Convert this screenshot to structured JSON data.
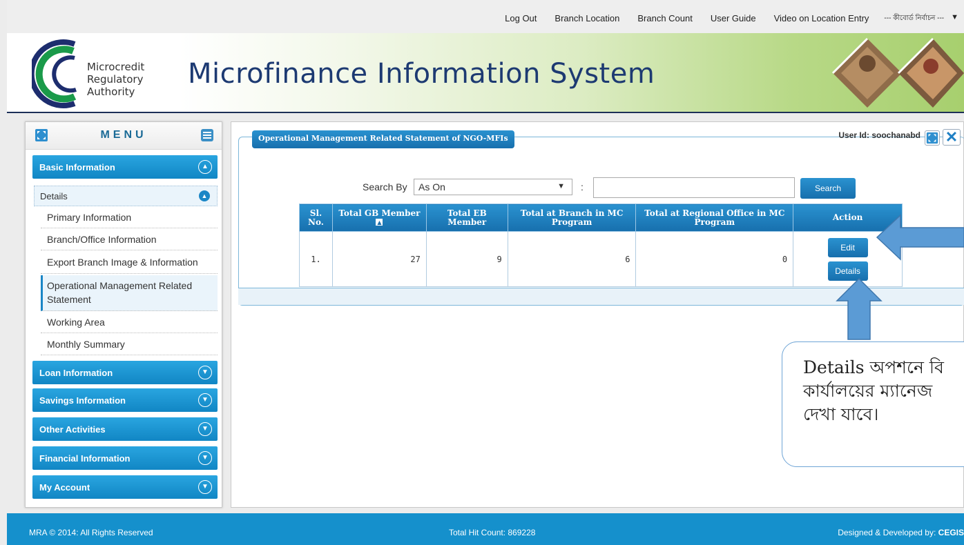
{
  "topnav": {
    "items": [
      "Log Out",
      "Branch Location",
      "Branch Count",
      "User Guide",
      "Video on Location Entry"
    ],
    "language": "--- কীবোর্ড নির্বাচন ---"
  },
  "banner": {
    "logo_lines": [
      "Microcredit",
      "Regulatory",
      "Authority"
    ],
    "title": "Microfinance Information System"
  },
  "sidebar": {
    "menu_title": "MENU",
    "basic_info": "Basic Information",
    "details": "Details",
    "items": [
      "Primary Information",
      "Branch/Office Information",
      "Export Branch Image & Information",
      "Operational Management Related Statement",
      "Working Area",
      "Monthly Summary"
    ],
    "categories": [
      "Loan Information",
      "Savings Information",
      "Other Activities",
      "Financial Information",
      "My Account"
    ]
  },
  "panel": {
    "legend": "Operational Management Related Statement of NGO-MFIs",
    "user_id": "User Id: soochanabd",
    "search_label": "Search By",
    "search_option": "As On",
    "colon": ":",
    "search_input": "",
    "search_button": "Search"
  },
  "table": {
    "headers": [
      "Sl. No.",
      "Total GB Member",
      "Total EB Member",
      "Total at Branch in MC Program",
      "Total at Regional Office in MC Program",
      "Action"
    ],
    "rows": [
      {
        "sl": "1.",
        "gb": "27",
        "eb": "9",
        "branch": "6",
        "regional": "0"
      }
    ],
    "edit_label": "Edit",
    "details_label": "Details"
  },
  "annotation": {
    "lines": [
      "Details অপশনে বি",
      "কার্যালয়ের ম্যানেজ",
      "দেখা যাবে।"
    ]
  },
  "footer": {
    "copyright": "MRA © 2014: All Rights Reserved",
    "hits": "Total Hit Count: 869228",
    "developer_prefix": "Designed & Developed by: ",
    "developer": "CEGIS"
  },
  "colors": {
    "accent_blue": "#1a86c6",
    "title_navy": "#1d3a72",
    "footer_blue": "#1590cc"
  }
}
